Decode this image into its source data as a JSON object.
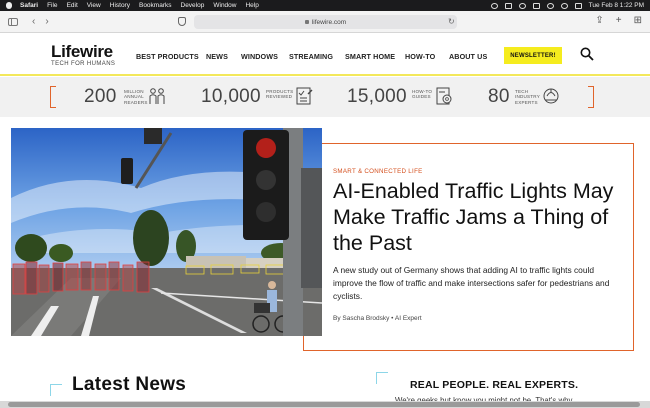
{
  "menubar": {
    "app": "Safari",
    "items": [
      "File",
      "Edit",
      "View",
      "History",
      "Bookmarks",
      "Develop",
      "Window",
      "Help"
    ],
    "datetime": "Tue Feb 8  1:22 PM"
  },
  "browser": {
    "url": "lifewire.com"
  },
  "site": {
    "logo": "Lifewire",
    "tagline": "TECH FOR HUMANS",
    "nav": [
      "BEST PRODUCTS",
      "NEWS",
      "WINDOWS",
      "STREAMING",
      "SMART HOME",
      "HOW-TO",
      "ABOUT US"
    ],
    "newsletter": "NEWSLETTER!"
  },
  "stats": [
    {
      "number": "200",
      "label": "MILLION ANNUAL READERS",
      "icon": "readers-icon"
    },
    {
      "number": "10,000",
      "label": "PRODUCTS REVIEWED",
      "icon": "checklist-icon"
    },
    {
      "number": "15,000",
      "label": "HOW-TO GUIDES",
      "icon": "guide-icon"
    },
    {
      "number": "80",
      "label": "TECH INDUSTRY EXPERTS",
      "icon": "expert-icon"
    }
  ],
  "hero": {
    "kicker": "SMART & CONNECTED LIFE",
    "headline": "AI-Enabled Traffic Lights May Make Traffic Jams a Thing of the Past",
    "summary": "A new study out of Germany shows that adding AI to traffic lights could improve the flow of traffic and make intersections safer for pedestrians and cyclists.",
    "byline": "By Sascha Brodsky  •  AI Expert",
    "image_alt": "Traffic light at intersection with pedestrians and cyclist"
  },
  "latest": {
    "title": "Latest News"
  },
  "about": {
    "title": "REAL PEOPLE. REAL EXPERTS.",
    "subtitle": "We're geeks but know you might not be. That's why"
  },
  "colors": {
    "accent_orange": "#e0642b",
    "newsletter_yellow": "#f5ec1e",
    "header_rule": "#f3e85b",
    "corner_cyan": "#8dd6e8"
  }
}
